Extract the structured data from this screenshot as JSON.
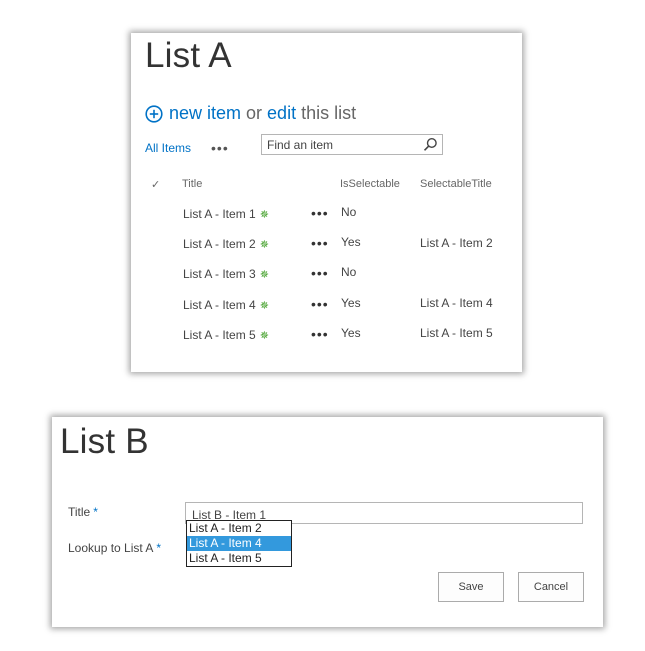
{
  "list_a": {
    "title": "List A",
    "new_item": "new item",
    "or": "or",
    "edit": "edit",
    "this_list": "this list",
    "view_name": "All Items",
    "more_label": "•••",
    "search_placeholder": "Find an item",
    "check_glyph": "✓",
    "columns": {
      "title": "Title",
      "is_selectable": "IsSelectable",
      "selectable_title": "SelectableTitle"
    },
    "items": [
      {
        "title": "List A - Item 1",
        "is_selectable": "No",
        "selectable_title": ""
      },
      {
        "title": "List A - Item 2",
        "is_selectable": "Yes",
        "selectable_title": "List A - Item 2"
      },
      {
        "title": "List A - Item 3",
        "is_selectable": "No",
        "selectable_title": ""
      },
      {
        "title": "List A - Item 4",
        "is_selectable": "Yes",
        "selectable_title": "List A - Item 4"
      },
      {
        "title": "List A - Item 5",
        "is_selectable": "Yes",
        "selectable_title": "List A - Item 5"
      }
    ],
    "new_glyph": "✵",
    "ellipsis": "•••"
  },
  "list_b": {
    "title": "List B",
    "title_label": "Title",
    "lookup_label": "Lookup to List A",
    "required": "*",
    "title_value": "List B - Item 1",
    "options": [
      "List A - Item 2",
      "List A - Item 4",
      "List A - Item 5"
    ],
    "selected_option": "List A - Item 4",
    "save": "Save",
    "cancel": "Cancel"
  },
  "colors": {
    "accent": "#0072c6",
    "selected_bg": "#3399dd",
    "new_icon": "#3a9b1f"
  },
  "icons": {
    "add": "plus-circle-icon",
    "search": "magnifier-icon",
    "check": "check-icon",
    "new": "new-item-icon"
  }
}
